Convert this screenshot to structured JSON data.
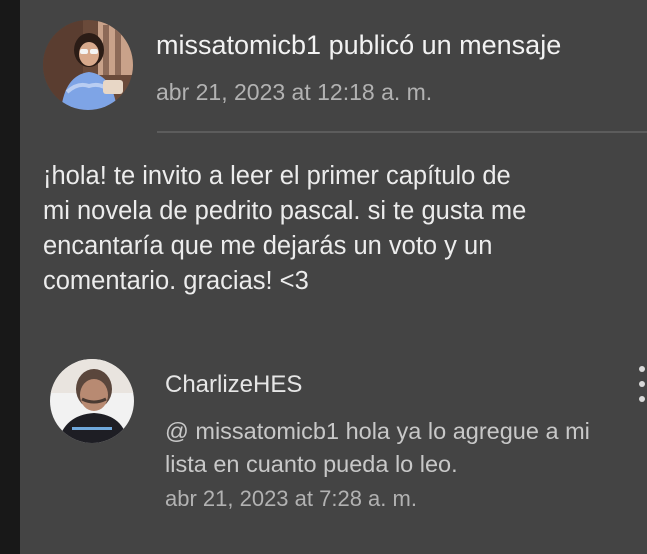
{
  "post": {
    "author": "missatomicb1",
    "action": "publicó un mensaje",
    "timestamp": "abr 21, 2023 at 12:18 a. m.",
    "body_lines": [
      "¡hola! te invito a leer el primer capítulo de",
      "mi novela de pedrito pascal. si te gusta me",
      "encantaría que me dejarás un voto y un",
      "comentario. gracias! <3"
    ],
    "avatar_icon": "user-avatar-photo"
  },
  "comment": {
    "author": "CharlizeHES",
    "mention": "@ missatomicb1",
    "text_line1": " hola ya lo agregue a mi",
    "text_line2": "lista en cuanto pueda lo leo.",
    "timestamp": "abr 21, 2023 at 7:28 a. m.",
    "menu_icon": "more-vertical-icon",
    "avatar_icon": "user-avatar-photo"
  },
  "colors": {
    "background": "#181818",
    "panel": "#444444",
    "primary_text": "#ececec",
    "secondary_text": "#b2b2b2"
  }
}
